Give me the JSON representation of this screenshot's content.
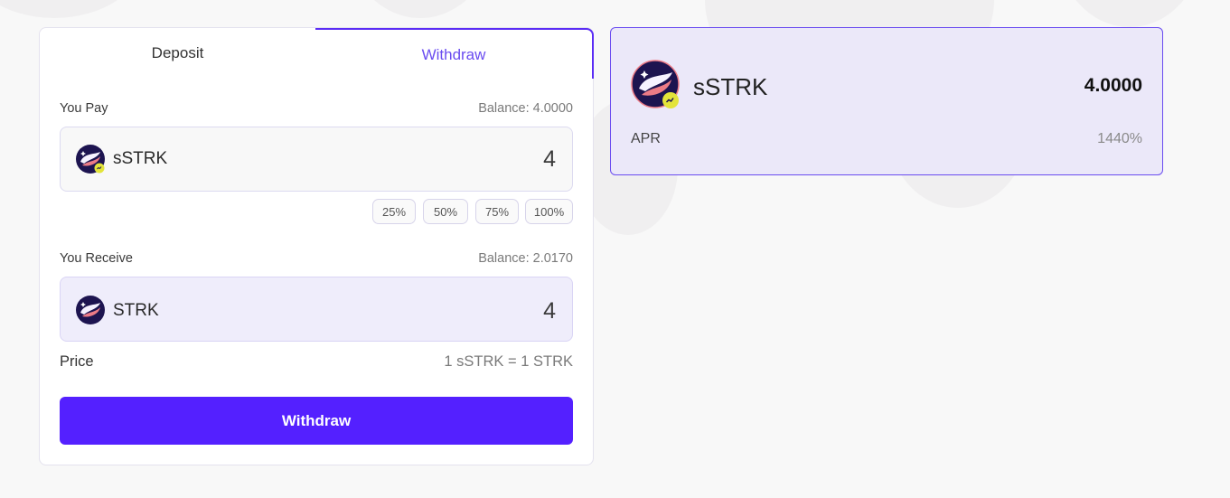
{
  "tabs": {
    "deposit": "Deposit",
    "withdraw": "Withdraw",
    "active": "withdraw"
  },
  "pay": {
    "label": "You Pay",
    "balance": "Balance: 4.0000",
    "token": "sSTRK",
    "amount": "4",
    "icon": "sstrk-token-icon"
  },
  "percent_buttons": [
    "25%",
    "50%",
    "75%",
    "100%"
  ],
  "receive": {
    "label": "You Receive",
    "balance": "Balance: 2.0170",
    "token": "STRK",
    "amount": "4",
    "icon": "strk-token-icon"
  },
  "price": {
    "label": "Price",
    "value": "1 sSTRK = 1 STRK"
  },
  "action": {
    "label": "Withdraw"
  },
  "summary": {
    "token": "sSTRK",
    "amount": "4.0000",
    "apr_label": "APR",
    "apr_value": "1440%"
  },
  "colors": {
    "accent": "#5420ff",
    "accent_border": "#6a4cf0",
    "tab_active_text": "#6a4cf0",
    "receive_bg": "#efedfb",
    "summary_bg": "#ebe8f9"
  }
}
